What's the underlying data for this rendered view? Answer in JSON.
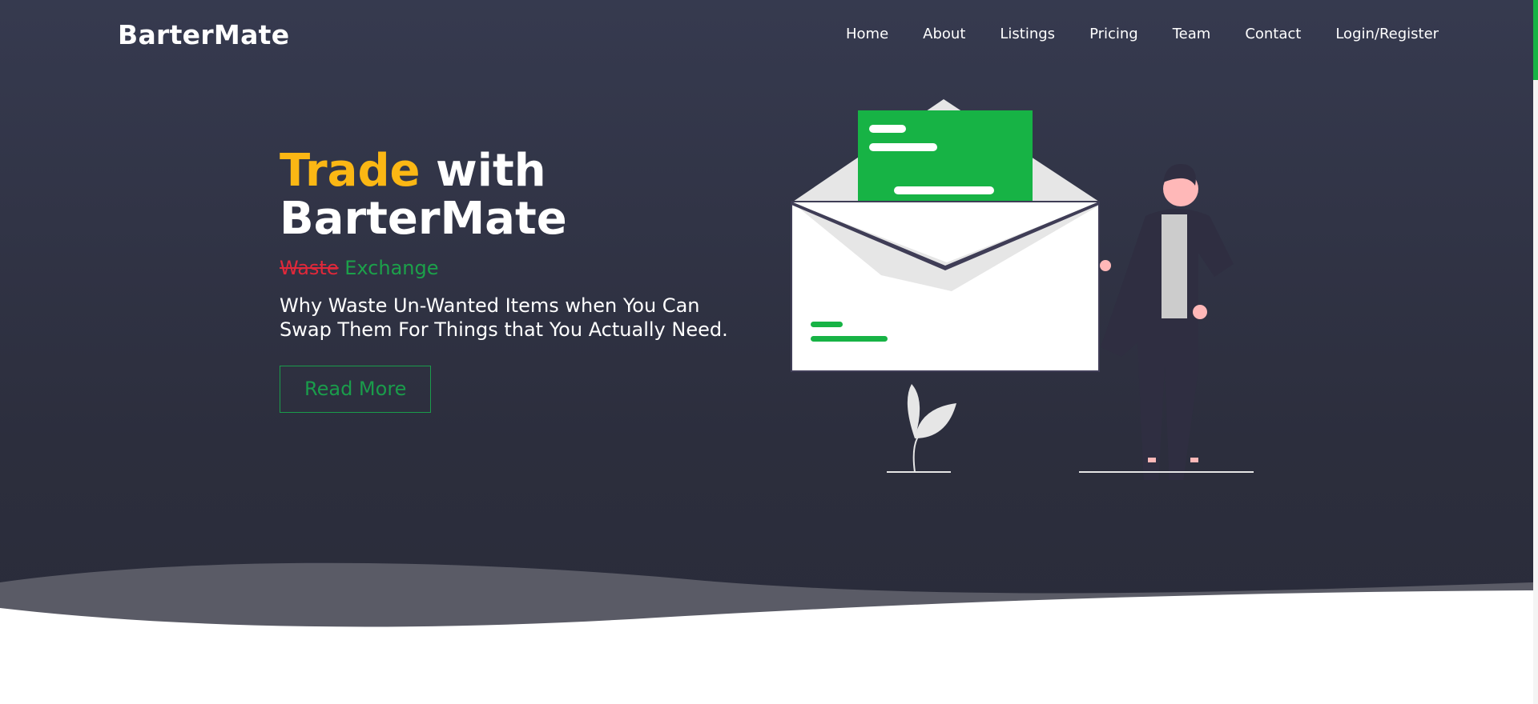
{
  "brand": {
    "name": "BarterMate"
  },
  "nav": {
    "items": [
      {
        "label": "Home"
      },
      {
        "label": "About"
      },
      {
        "label": "Listings"
      },
      {
        "label": "Pricing"
      },
      {
        "label": "Team"
      },
      {
        "label": "Contact"
      },
      {
        "label": "Login/Register"
      }
    ]
  },
  "hero": {
    "headline_accent": "Trade",
    "headline_rest": "with",
    "headline_line2": "BarterMate",
    "tagline_struck": "Waste",
    "tagline_ok": "Exchange",
    "subtitle": "Why Waste Un-Wanted Items when You Can Swap Them For Things that You Actually Need.",
    "cta_label": "Read More"
  },
  "colors": {
    "background": "#363a4f",
    "accent_yellow": "#fbb714",
    "accent_green": "#17b345",
    "strike_red": "#e0283a",
    "text_light": "#ffffff"
  },
  "icons": {
    "illustration": "envelope-person-illustration",
    "plant": "plant-icon"
  }
}
